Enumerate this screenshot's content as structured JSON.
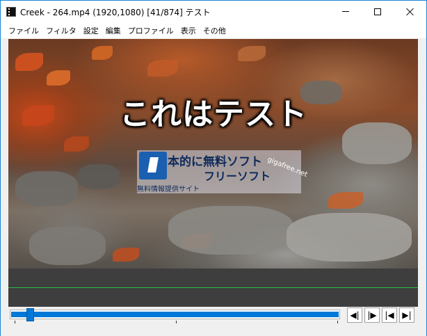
{
  "window": {
    "title": "Creek - 264.mp4 (1920,1080)  [41/874]  テスト"
  },
  "menubar": {
    "items": [
      "ファイル",
      "フィルタ",
      "設定",
      "編集",
      "プロファイル",
      "表示",
      "その他"
    ]
  },
  "video": {
    "overlay_text": "これはテスト",
    "watermark": {
      "line1": "本的に無料ソフト",
      "line2": "フリーソフト",
      "tagline": "無料情報提供サイト",
      "domain": "gigafree.net"
    }
  },
  "seek": {
    "current_frame": 41,
    "total_frames": 874
  },
  "nav_buttons": {
    "prev": "◀|",
    "next": "|▶",
    "first": "|◀",
    "last": "▶|"
  },
  "colors": {
    "accent": "#0078d7",
    "timeline_bg": "#3e3e3e",
    "timeline_line": "#22c040"
  }
}
